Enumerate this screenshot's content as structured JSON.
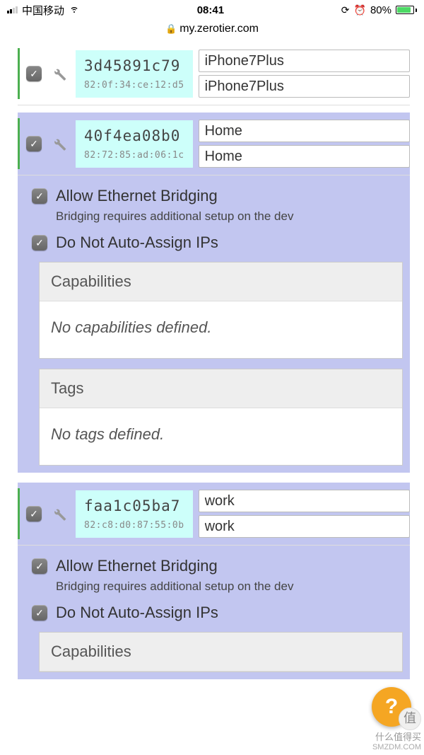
{
  "status": {
    "carrier": "中国移动",
    "time": "08:41",
    "battery_pct": "80%"
  },
  "url": "my.zerotier.com",
  "members": [
    {
      "checked": true,
      "node_id": "3d45891c79",
      "mac": "82:0f:34:ce:12:d5",
      "name1": "iPhone7Plus",
      "name2": "iPhone7Plus",
      "expanded": false
    },
    {
      "checked": true,
      "node_id": "40f4ea08b0",
      "mac": "82:72:85:ad:06:1c",
      "name1": "Home",
      "name2": "Home",
      "expanded": true
    },
    {
      "checked": true,
      "node_id": "faa1c05ba7",
      "mac": "82:c8:d0:87:55:0b",
      "name1": "work",
      "name2": "work",
      "expanded": true
    }
  ],
  "options": {
    "allow_bridging": {
      "checked": true,
      "label": "Allow Ethernet Bridging",
      "hint": "Bridging requires additional setup on the dev"
    },
    "no_auto_ip": {
      "checked": true,
      "label": "Do Not Auto-Assign IPs"
    }
  },
  "panels": {
    "capabilities": {
      "title": "Capabilities",
      "body": "No capabilities defined."
    },
    "tags": {
      "title": "Tags",
      "body": "No tags defined."
    }
  },
  "help_label": "?",
  "watermark": {
    "cn": "什么值得买",
    "en": "SMZDM.COM",
    "icon": "值"
  }
}
